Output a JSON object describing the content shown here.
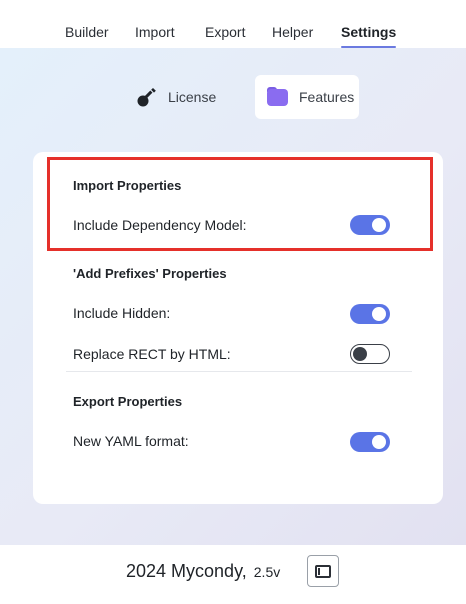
{
  "nav": {
    "tabs": [
      {
        "label": "Builder"
      },
      {
        "label": "Import"
      },
      {
        "label": "Export"
      },
      {
        "label": "Helper"
      },
      {
        "label": "Settings"
      }
    ],
    "active_tab": "Settings"
  },
  "subtabs": {
    "license": {
      "label": "License",
      "icon": "key-icon"
    },
    "features": {
      "label": "Features",
      "icon": "folder-icon"
    }
  },
  "settings": {
    "import": {
      "title": "Import Properties",
      "include_dependency_model": {
        "label": "Include Dependency Model:",
        "enabled": true
      }
    },
    "prefixes": {
      "title": "'Add Prefixes' Properties",
      "include_hidden": {
        "label": "Include Hidden:",
        "enabled": true
      },
      "replace_rect": {
        "label": "Replace RECT by HTML:",
        "enabled": false
      }
    },
    "export": {
      "title": "Export Properties",
      "new_yaml": {
        "label": "New YAML format:",
        "enabled": true
      }
    }
  },
  "footer": {
    "text": "2024 Mycondy,",
    "version": "2.5v",
    "sidebar_icon": "sidebar-toggle-icon"
  },
  "colors": {
    "accent": "#5a74e6",
    "highlight": "#e5302a",
    "tab_underline": "#6b7ae0"
  }
}
